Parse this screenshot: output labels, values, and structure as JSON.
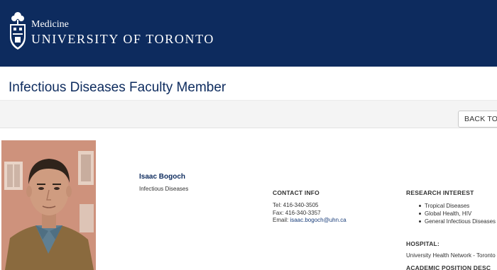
{
  "header": {
    "subtitle": "Medicine",
    "title": "UNIVERSITY OF TORONTO",
    "crest_icon": "university-crest-icon",
    "background": "#0d2b5e"
  },
  "page": {
    "title": "Infectious Diseases Faculty Member"
  },
  "toolbar": {
    "back_label": "BACK TO D"
  },
  "profile": {
    "name": "Isaac Bogoch",
    "division": "Infectious Diseases"
  },
  "contact": {
    "heading": "CONTACT INFO",
    "tel": "Tel: 416-340-3505",
    "fax": "Fax: 416-340-3357",
    "email_label": "Email: ",
    "email": "isaac.bogoch@uhn.ca"
  },
  "research": {
    "heading": "RESEARCH INTEREST",
    "items": [
      "Tropical Diseases",
      "Global Health, HIV",
      "General Infectious Diseases"
    ]
  },
  "hospital": {
    "heading": "HOSPITAL:",
    "value": "University Health Network - Toronto"
  },
  "academic": {
    "heading": "ACADEMIC POSITION DESC"
  },
  "colors": {
    "brand_navy": "#0d2b5e",
    "link": "#1a3e7a"
  }
}
